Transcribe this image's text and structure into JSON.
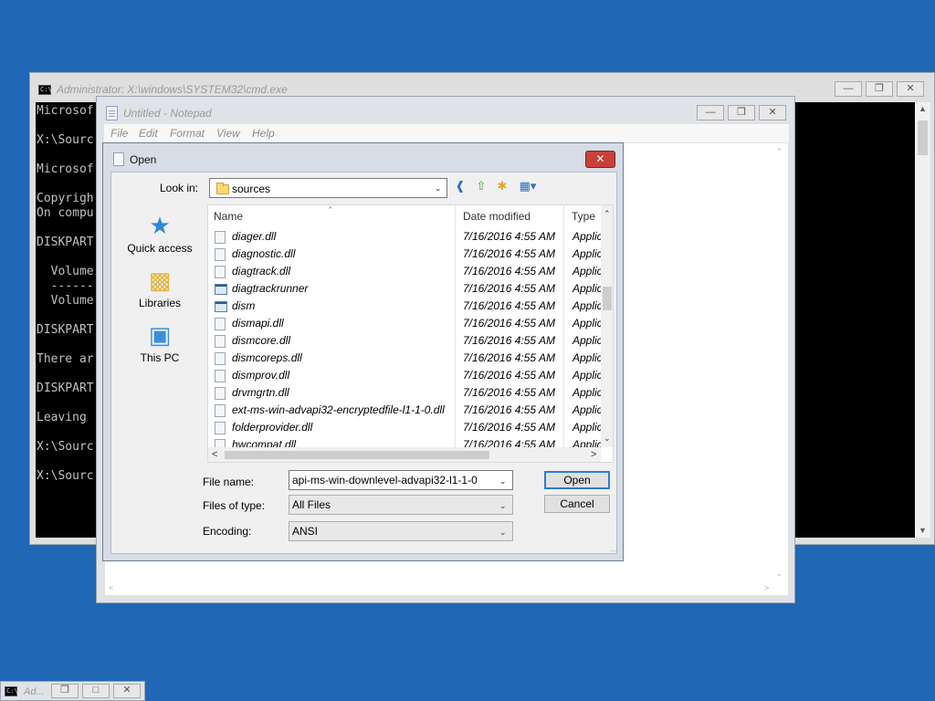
{
  "cmd": {
    "title": "Administrator: X:\\windows\\SYSTEM32\\cmd.exe",
    "icon": "cmd-icon",
    "lines": [
      "Microsof",
      "",
      "X:\\Sourc",
      "",
      "Microsof",
      "",
      "Copyrigh",
      "On compu",
      "",
      "DISKPART",
      "",
      "  Volume",
      "  ------",
      "  Volume",
      "",
      "DISKPART",
      "",
      "There ar",
      "",
      "DISKPART",
      "",
      "Leaving ",
      "",
      "X:\\Sourc",
      "",
      "X:\\Sourc"
    ]
  },
  "notepad": {
    "title": "Untitled - Notepad",
    "menu": [
      "File",
      "Edit",
      "Format",
      "View",
      "Help"
    ]
  },
  "dialog": {
    "title": "Open",
    "look_in_label": "Look in:",
    "look_in_value": "sources",
    "places": [
      {
        "label": "Quick access",
        "icon": "star-icon"
      },
      {
        "label": "Libraries",
        "icon": "libraries-icon"
      },
      {
        "label": "This PC",
        "icon": "computer-icon"
      }
    ],
    "columns": [
      "Name",
      "Date modified",
      "Type"
    ],
    "files": [
      {
        "name": "diager.dll",
        "date": "7/16/2016 4:55 AM",
        "type": "Applic",
        "kind": "dll"
      },
      {
        "name": "diagnostic.dll",
        "date": "7/16/2016 4:55 AM",
        "type": "Applic",
        "kind": "dll"
      },
      {
        "name": "diagtrack.dll",
        "date": "7/16/2016 4:55 AM",
        "type": "Applic",
        "kind": "dll"
      },
      {
        "name": "diagtrackrunner",
        "date": "7/16/2016 4:55 AM",
        "type": "Applic",
        "kind": "exe"
      },
      {
        "name": "dism",
        "date": "7/16/2016 4:55 AM",
        "type": "Applic",
        "kind": "exe"
      },
      {
        "name": "dismapi.dll",
        "date": "7/16/2016 4:55 AM",
        "type": "Applic",
        "kind": "dll"
      },
      {
        "name": "dismcore.dll",
        "date": "7/16/2016 4:55 AM",
        "type": "Applic",
        "kind": "dll"
      },
      {
        "name": "dismcoreps.dll",
        "date": "7/16/2016 4:55 AM",
        "type": "Applic",
        "kind": "dll"
      },
      {
        "name": "dismprov.dll",
        "date": "7/16/2016 4:55 AM",
        "type": "Applic",
        "kind": "dll"
      },
      {
        "name": "drvmgrtn.dll",
        "date": "7/16/2016 4:55 AM",
        "type": "Applic",
        "kind": "dll"
      },
      {
        "name": "ext-ms-win-advapi32-encryptedfile-l1-1-0.dll",
        "date": "7/16/2016 4:55 AM",
        "type": "Applic",
        "kind": "dll"
      },
      {
        "name": "folderprovider.dll",
        "date": "7/16/2016 4:55 AM",
        "type": "Applic",
        "kind": "dll"
      },
      {
        "name": "hwcompat.dll",
        "date": "7/16/2016 4:55 AM",
        "type": "Applic",
        "kind": "dll"
      }
    ],
    "file_name_label": "File name:",
    "file_name_value": "api-ms-win-downlevel-advapi32-l1-1-0",
    "files_of_type_label": "Files of type:",
    "files_of_type_value": "All Files",
    "encoding_label": "Encoding:",
    "encoding_value": "ANSI",
    "open_label": "Open",
    "cancel_label": "Cancel"
  },
  "minimized": {
    "title": "Ad...",
    "icon": "cmd-icon"
  },
  "colors": {
    "desktop": "#2067b5",
    "close_button": "#c94038",
    "default_button_border": "#2f7bd6"
  }
}
